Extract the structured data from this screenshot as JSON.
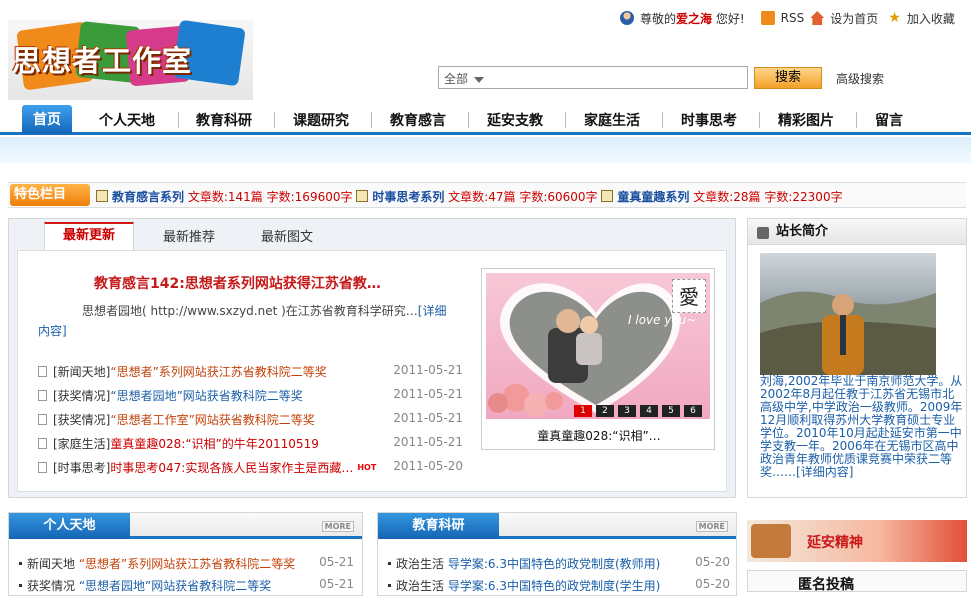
{
  "header": {
    "logo_text": "思想者工作室",
    "greeting_prefix": "尊敬的",
    "user": "爱之海",
    "greeting_suffix": "您好!",
    "rss": "RSS",
    "set_home": "设为首页",
    "favorite": "加入收藏",
    "search_scope": "全部",
    "search_button": "搜索",
    "advanced_search": "高级搜索"
  },
  "nav": {
    "items": [
      "首页",
      "个人天地",
      "教育科研",
      "课题研究",
      "教育感言",
      "延安支教",
      "家庭生活",
      "时事思考",
      "精彩图片",
      "留言"
    ]
  },
  "special": {
    "label": "特色栏目",
    "items": [
      {
        "name": "教育感言系列",
        "articles": "文章数:141篇",
        "chars": "字数:169600字"
      },
      {
        "name": "时事思考系列",
        "articles": "文章数:47篇",
        "chars": "字数:60600字"
      },
      {
        "name": "童真童趣系列",
        "articles": "文章数:28篇",
        "chars": "字数:22300字"
      }
    ]
  },
  "main": {
    "tabs": [
      "最新更新",
      "最新推荐",
      "最新图文"
    ],
    "headline": "教育感言142:思想者系列网站获得江苏省教…",
    "summary": "思想者园地( http://www.sxzyd.net )在江苏省教育科学研究…",
    "detail_link": "[详细内容]",
    "list": [
      {
        "cat": "[新闻天地]",
        "title": "“思想者”系列网站获江苏省教科院二等奖",
        "color": "red",
        "date": "2011-05-21",
        "hot": false
      },
      {
        "cat": "[获奖情况]",
        "title": "“思想者园地”网站获省教科院二等奖",
        "color": "blue",
        "date": "2011-05-21",
        "hot": false
      },
      {
        "cat": "[获奖情况]",
        "title": "“思想者工作室”网站获省教科院二等奖",
        "color": "red",
        "date": "2011-05-21",
        "hot": false
      },
      {
        "cat": "[家庭生活]",
        "title": "童真童趣028:“识相”的牛年20110519",
        "color": "red",
        "date": "2011-05-21",
        "hot": false
      },
      {
        "cat": "[时事思考]",
        "title": "时事思考047:实现各族人民当家作主是西藏…",
        "color": "red",
        "date": "2011-05-20",
        "hot": true
      }
    ],
    "hot_badge": "HOT",
    "photo": {
      "text": "I love you~",
      "stamp": "愛",
      "caption": "童真童趣028:“识相”…",
      "pages": [
        "1",
        "2",
        "3",
        "4",
        "5",
        "6"
      ]
    }
  },
  "profile": {
    "title": "站长简介",
    "text": "刘海,2002年毕业于南京师范大学。从2002年8月起任教于江苏省无锡市北高级中学,中学政治一级教师。2009年12月顺利取得苏州大学教育硕士专业学位。2010年10月起赴延安市第一中学支教一年。2006年在无锡市区高中政治青年教师优质课竞赛中荣获二等奖……",
    "detail_link": "[详细内容]"
  },
  "bottom": {
    "left": {
      "title": "个人天地",
      "more": "MORE",
      "rows": [
        {
          "cat": "新闻天地",
          "title": "“思想者”系列网站获江苏省教科院二等奖",
          "color": "red",
          "date": "05-21"
        },
        {
          "cat": "获奖情况",
          "title": "“思想者园地”网站获省教科院二等奖",
          "color": "blue",
          "date": "05-21"
        }
      ]
    },
    "right": {
      "title": "教育科研",
      "more": "MORE",
      "rows": [
        {
          "cat": "政治生活",
          "title": "导学案:6.3中国特色的政党制度(教师用)",
          "color": "blue",
          "date": "05-20"
        },
        {
          "cat": "政治生活",
          "title": "导学案:6.3中国特色的政党制度(学生用)",
          "color": "blue",
          "date": "05-20"
        }
      ]
    },
    "ad_text": "延安精神",
    "anon": "匿名投稿"
  },
  "colors": {
    "accent": "#1b74c3",
    "red": "#c00000",
    "orange": "#ef7f0a"
  }
}
